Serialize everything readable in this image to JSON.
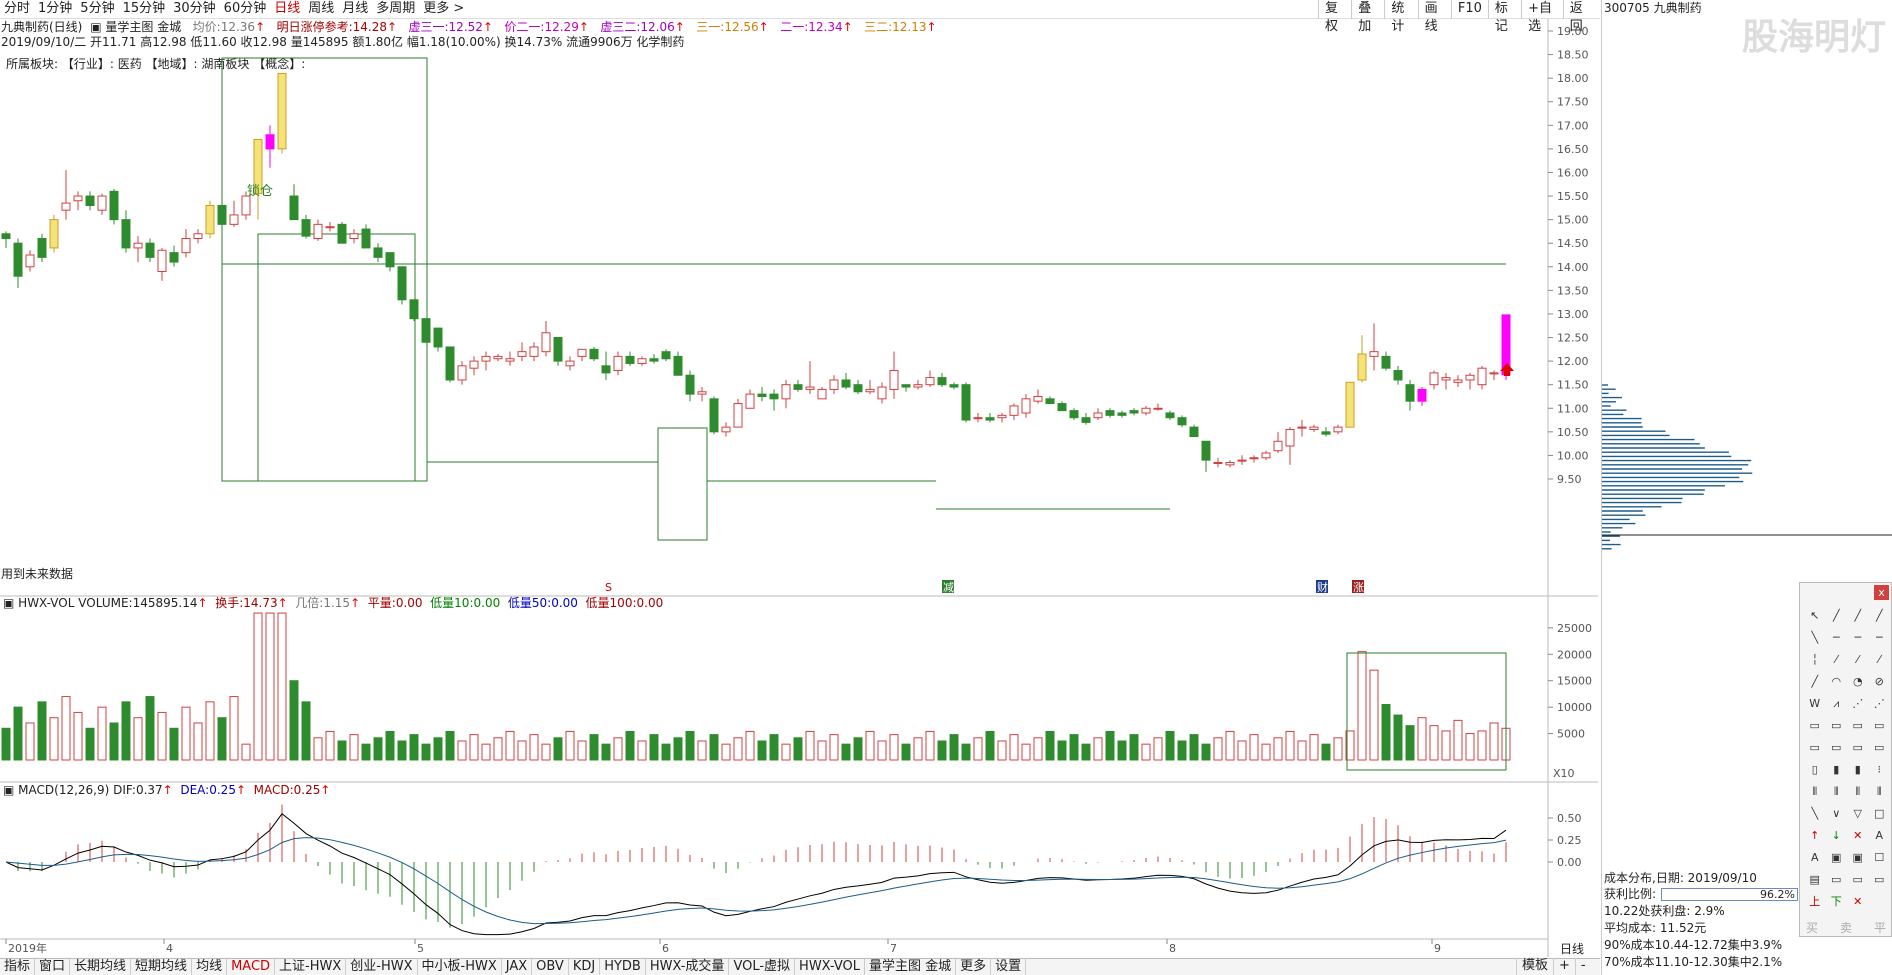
{
  "toolbar": {
    "timeframes": [
      "分时",
      "1分钟",
      "5分钟",
      "15分钟",
      "30分钟",
      "60分钟",
      "日线",
      "周线",
      "月线",
      "多周期",
      "更多 >"
    ],
    "active": "日线",
    "right": [
      "复权",
      "叠加",
      "统计",
      "画线",
      "F10",
      "标记",
      "+自选",
      "返回"
    ]
  },
  "header": {
    "stock_title": "九典制药(日线)",
    "indicator_name": "量学主图 金城",
    "avg_label": "均价:",
    "avg_value": "12.36",
    "mingri_label": "明日涨停参考:",
    "mingri_value": "14.28",
    "xu31_label": "虚三一:",
    "xu31_value": "12.52",
    "jia21_label": "价二一:",
    "jia21_value": "12.29",
    "xu32_label": "虚三二:",
    "xu32_value": "12.06",
    "san1_label": "三一:",
    "san1_value": "12.56",
    "er1_label": "二一:",
    "er1_value": "12.34",
    "san2_label": "三二:",
    "san2_value": "12.13",
    "line2": "2019/09/10/二  开11.71  高12.98  低11.60  收12.98  量145895  额1.80亿  幅1.18(10.00%)  换14.73%  流通9906万  化学制药",
    "line3": "所属板块:     【行业】: 医药      【地域】: 湖南板块      【概念】:",
    "future_label": "用到未来数据",
    "lock_label": "锁仓"
  },
  "right_axis": [
    "19.00",
    "18.50",
    "18.00",
    "17.50",
    "17.00",
    "16.50",
    "16.00",
    "15.50",
    "15.00",
    "14.50",
    "14.00",
    "13.50",
    "13.00",
    "12.50",
    "12.00",
    "11.50",
    "11.00",
    "10.50",
    "10.00",
    "9.50"
  ],
  "vol_header": {
    "name": "HWX-VOL",
    "vol_label": "VOLUME:",
    "vol_value": "145895.14",
    "hs_label": "换手:",
    "hs_value": "14.73",
    "jb_label": "几倍:",
    "jb_value": "1.15",
    "pl_label": "平量:",
    "pl_value": "0.00",
    "d10_label": "低量10:",
    "d10_value": "0.00",
    "d50_label": "低量50:",
    "d50_value": "0.00",
    "d100_label": "低量100:",
    "d100_value": "0.00"
  },
  "vol_axis": [
    "25000",
    "20000",
    "15000",
    "10000",
    "5000"
  ],
  "vol_unit": "X10",
  "macd_header": {
    "name": "MACD(12,26,9)",
    "dif_label": "DIF:",
    "dif_value": "0.37",
    "dea_label": "DEA:",
    "dea_value": "0.25",
    "macd_label": "MACD:",
    "macd_value": "0.25"
  },
  "macd_axis": [
    "0.50",
    "0.25",
    "0.00"
  ],
  "date_axis": [
    "2019年",
    "4",
    "5",
    "6",
    "7",
    "8",
    "9"
  ],
  "markers": {
    "s": "S",
    "jian": "减",
    "cai": "财",
    "zhang": "涨"
  },
  "right_panel": {
    "code_title": "300705 九典制药",
    "watermark": "股海明灯",
    "cost_title": "成本分布,日期:  2019/09/10",
    "profit_label": "获利比例:",
    "profit_value": "96.2%",
    "line1": "10.22处获利盘:  2.9%",
    "line2": "平均成本:  11.52元",
    "line3": "90%成本10.44-12.72集中3.9%",
    "line4": "70%成本11.10-12.30集中2.1%",
    "period": "日线",
    "buy": "买",
    "sell": "卖",
    "flat": "平"
  },
  "bottom_tabs": [
    "指标",
    "窗口",
    "长期均线",
    "短期均线",
    "均线",
    "MACD",
    "上证-HWX",
    "创业-HWX",
    "中小板-HWX",
    "JAX",
    "OBV",
    "KDJ",
    "HYDB",
    "HWX-成交量",
    "VOL-虚拟",
    "HWX-VOL",
    "量学主图 金城",
    "更多",
    "设置"
  ],
  "bottom_active": "MACD",
  "bottom_right": [
    "模板",
    "+",
    "-"
  ],
  "colors": {
    "up": "#d04040",
    "down": "#2e8b2e",
    "yellow_up": "#f5e37a",
    "magenta": "#ff00ff",
    "box": "#2e7d2e"
  },
  "chart_data": {
    "type": "candlestick",
    "ylim": [
      9.3,
      19.2
    ],
    "candles": [
      [
        12,
        14.7,
        14.75,
        14.4,
        14.6
      ],
      [
        12,
        14.5,
        14.6,
        13.55,
        13.8
      ],
      [
        12,
        14.0,
        14.35,
        13.9,
        14.25
      ],
      [
        12,
        14.6,
        14.7,
        14.1,
        14.2
      ],
      [
        12,
        14.4,
        15.1,
        14.3,
        15.0
      ],
      [
        12,
        15.2,
        16.05,
        15.0,
        15.35
      ],
      [
        12,
        15.4,
        15.6,
        15.2,
        15.5
      ],
      [
        12,
        15.5,
        15.6,
        15.2,
        15.3
      ],
      [
        12,
        15.2,
        15.55,
        15.1,
        15.5
      ],
      [
        12,
        15.6,
        15.65,
        14.9,
        15.0
      ],
      [
        12,
        15.0,
        15.2,
        14.3,
        14.4
      ],
      [
        12,
        14.4,
        14.65,
        14.1,
        14.5
      ],
      [
        12,
        14.5,
        14.6,
        14.1,
        14.2
      ],
      [
        12,
        13.9,
        14.4,
        13.7,
        14.35
      ],
      [
        12,
        14.3,
        14.45,
        14.0,
        14.1
      ],
      [
        12,
        14.3,
        14.8,
        14.2,
        14.6
      ],
      [
        12,
        14.6,
        14.8,
        14.5,
        14.7
      ],
      [
        12,
        14.7,
        15.4,
        14.6,
        15.3
      ],
      [
        12,
        15.3,
        15.35,
        14.9,
        14.9
      ],
      [
        12,
        14.9,
        15.4,
        14.85,
        15.1
      ],
      [
        12,
        15.1,
        15.6,
        15.0,
        15.5
      ],
      [
        12,
        15.55,
        16.7,
        15.0,
        16.7
      ],
      [
        12,
        16.5,
        17.0,
        16.1,
        16.8
      ],
      [
        12,
        16.5,
        18.1,
        16.4,
        18.1
      ],
      [
        12,
        15.5,
        15.75,
        15.0,
        15.0
      ],
      [
        12,
        15.0,
        15.1,
        14.6,
        14.65
      ],
      [
        12,
        14.6,
        15.0,
        14.55,
        14.9
      ],
      [
        12,
        14.85,
        14.95,
        14.75,
        14.85
      ],
      [
        12,
        14.9,
        14.95,
        14.5,
        14.5
      ],
      [
        12,
        14.6,
        14.8,
        14.5,
        14.7
      ],
      [
        12,
        14.8,
        14.9,
        14.4,
        14.4
      ],
      [
        12,
        14.4,
        14.5,
        14.1,
        14.2
      ],
      [
        12,
        14.3,
        14.3,
        13.9,
        14.0
      ],
      [
        12,
        14.0,
        14.0,
        13.2,
        13.3
      ],
      [
        12,
        13.3,
        13.3,
        12.85,
        12.9
      ],
      [
        12,
        12.9,
        12.9,
        12.4,
        12.4
      ],
      [
        12,
        12.7,
        12.7,
        12.2,
        12.3
      ],
      [
        12,
        12.3,
        12.3,
        11.55,
        11.6
      ],
      [
        12,
        11.6,
        12.0,
        11.5,
        11.9
      ],
      [
        12,
        11.85,
        12.1,
        11.7,
        12.0
      ],
      [
        12,
        12.0,
        12.2,
        11.8,
        12.1
      ],
      [
        12,
        12.05,
        12.15,
        12.0,
        12.1
      ],
      [
        12,
        12.0,
        12.2,
        11.9,
        12.05
      ],
      [
        12,
        12.1,
        12.4,
        12.0,
        12.2
      ],
      [
        12,
        12.1,
        12.4,
        12.0,
        12.3
      ],
      [
        12,
        12.2,
        12.85,
        12.1,
        12.6
      ],
      [
        12,
        12.5,
        12.5,
        11.9,
        12.0
      ],
      [
        12,
        11.9,
        12.1,
        11.8,
        12.0
      ],
      [
        12,
        12.1,
        12.25,
        12.0,
        12.25
      ],
      [
        12,
        12.25,
        12.3,
        12.0,
        12.05
      ],
      [
        12,
        11.9,
        12.2,
        11.6,
        11.75
      ],
      [
        12,
        11.8,
        12.2,
        11.7,
        12.1
      ],
      [
        12,
        12.1,
        12.2,
        11.9,
        11.95
      ],
      [
        12,
        11.95,
        12.1,
        11.9,
        12.05
      ],
      [
        12,
        12.05,
        12.15,
        11.95,
        12.0
      ],
      [
        12,
        12.2,
        12.25,
        12.0,
        12.05
      ],
      [
        12,
        12.1,
        12.2,
        11.7,
        11.7
      ],
      [
        12,
        11.7,
        11.8,
        11.15,
        11.3
      ],
      [
        12,
        11.3,
        11.45,
        11.15,
        11.35
      ],
      [
        12,
        11.2,
        11.25,
        10.45,
        10.5
      ],
      [
        12,
        10.5,
        10.7,
        10.4,
        10.6
      ],
      [
        12,
        10.6,
        11.2,
        10.6,
        11.1
      ],
      [
        12,
        11.0,
        11.4,
        11.0,
        11.3
      ],
      [
        12,
        11.3,
        11.45,
        11.15,
        11.25
      ],
      [
        12,
        11.3,
        11.4,
        10.95,
        11.2
      ],
      [
        12,
        11.2,
        11.6,
        11.0,
        11.5
      ],
      [
        12,
        11.5,
        11.6,
        11.35,
        11.4
      ],
      [
        12,
        11.4,
        12.0,
        11.3,
        11.45
      ],
      [
        12,
        11.2,
        11.45,
        11.2,
        11.4
      ],
      [
        12,
        11.4,
        11.7,
        11.3,
        11.6
      ],
      [
        12,
        11.6,
        11.75,
        11.4,
        11.45
      ],
      [
        12,
        11.5,
        11.6,
        11.3,
        11.35
      ],
      [
        12,
        11.35,
        11.6,
        11.3,
        11.4
      ],
      [
        12,
        11.2,
        11.55,
        11.1,
        11.45
      ],
      [
        12,
        11.4,
        12.2,
        11.2,
        11.8
      ],
      [
        12,
        11.5,
        11.5,
        11.35,
        11.45
      ],
      [
        12,
        11.45,
        11.6,
        11.4,
        11.5
      ],
      [
        12,
        11.5,
        11.8,
        11.45,
        11.65
      ],
      [
        12,
        11.65,
        11.75,
        11.45,
        11.5
      ],
      [
        12,
        11.5,
        11.55,
        11.4,
        11.45
      ],
      [
        12,
        11.5,
        11.55,
        10.7,
        10.75
      ],
      [
        12,
        10.8,
        10.9,
        10.7,
        10.8
      ],
      [
        12,
        10.8,
        10.9,
        10.7,
        10.75
      ],
      [
        12,
        10.8,
        10.9,
        10.7,
        10.85
      ],
      [
        12,
        10.85,
        11.1,
        10.75,
        11.05
      ],
      [
        12,
        10.9,
        11.3,
        10.8,
        11.2
      ],
      [
        12,
        11.15,
        11.4,
        11.1,
        11.25
      ],
      [
        12,
        11.2,
        11.25,
        11.1,
        11.1
      ],
      [
        12,
        11.1,
        11.15,
        10.95,
        10.95
      ],
      [
        12,
        10.95,
        11.0,
        10.75,
        10.8
      ],
      [
        12,
        10.8,
        10.9,
        10.65,
        10.7
      ],
      [
        12,
        10.8,
        11.0,
        10.75,
        10.9
      ],
      [
        12,
        10.95,
        11.0,
        10.8,
        10.85
      ],
      [
        12,
        10.9,
        10.95,
        10.8,
        10.85
      ],
      [
        12,
        10.95,
        11.0,
        10.85,
        10.9
      ],
      [
        12,
        10.9,
        11.05,
        10.85,
        11.0
      ],
      [
        12,
        11.0,
        11.1,
        10.95,
        11.0
      ],
      [
        12,
        10.9,
        10.95,
        10.75,
        10.8
      ],
      [
        12,
        10.8,
        10.85,
        10.6,
        10.65
      ],
      [
        12,
        10.6,
        10.65,
        10.4,
        10.4
      ],
      [
        12,
        10.3,
        10.3,
        9.65,
        9.9
      ],
      [
        12,
        9.85,
        9.95,
        9.75,
        9.85
      ],
      [
        12,
        9.8,
        9.9,
        9.75,
        9.85
      ],
      [
        12,
        9.9,
        10.0,
        9.8,
        9.9
      ],
      [
        12,
        9.95,
        10.0,
        9.85,
        9.95
      ],
      [
        12,
        9.95,
        10.1,
        9.9,
        10.05
      ],
      [
        12,
        10.1,
        10.5,
        10.05,
        10.3
      ],
      [
        12,
        10.2,
        10.6,
        9.8,
        10.55
      ],
      [
        12,
        10.6,
        10.75,
        10.4,
        10.6
      ],
      [
        12,
        10.55,
        10.65,
        10.5,
        10.6
      ],
      [
        12,
        10.5,
        10.6,
        10.4,
        10.45
      ],
      [
        12,
        10.5,
        10.65,
        10.45,
        10.6
      ],
      [
        12,
        10.6,
        11.55,
        10.6,
        11.55
      ],
      [
        12,
        11.6,
        12.55,
        11.55,
        12.15
      ],
      [
        12,
        12.1,
        12.8,
        11.8,
        12.2
      ],
      [
        12,
        12.1,
        12.2,
        11.8,
        11.85
      ],
      [
        12,
        11.8,
        11.9,
        11.5,
        11.6
      ],
      [
        12,
        11.5,
        11.6,
        10.95,
        11.15
      ],
      [
        12,
        11.15,
        11.45,
        11.05,
        11.4
      ],
      [
        12,
        11.5,
        11.8,
        11.4,
        11.75
      ],
      [
        12,
        11.6,
        11.75,
        11.4,
        11.65
      ],
      [
        12,
        11.55,
        11.7,
        11.45,
        11.6
      ],
      [
        12,
        11.6,
        11.75,
        11.4,
        11.7
      ],
      [
        12,
        11.5,
        11.9,
        11.4,
        11.85
      ],
      [
        12,
        11.75,
        11.8,
        11.6,
        11.75
      ],
      [
        12,
        11.71,
        12.98,
        11.6,
        12.98
      ]
    ]
  }
}
